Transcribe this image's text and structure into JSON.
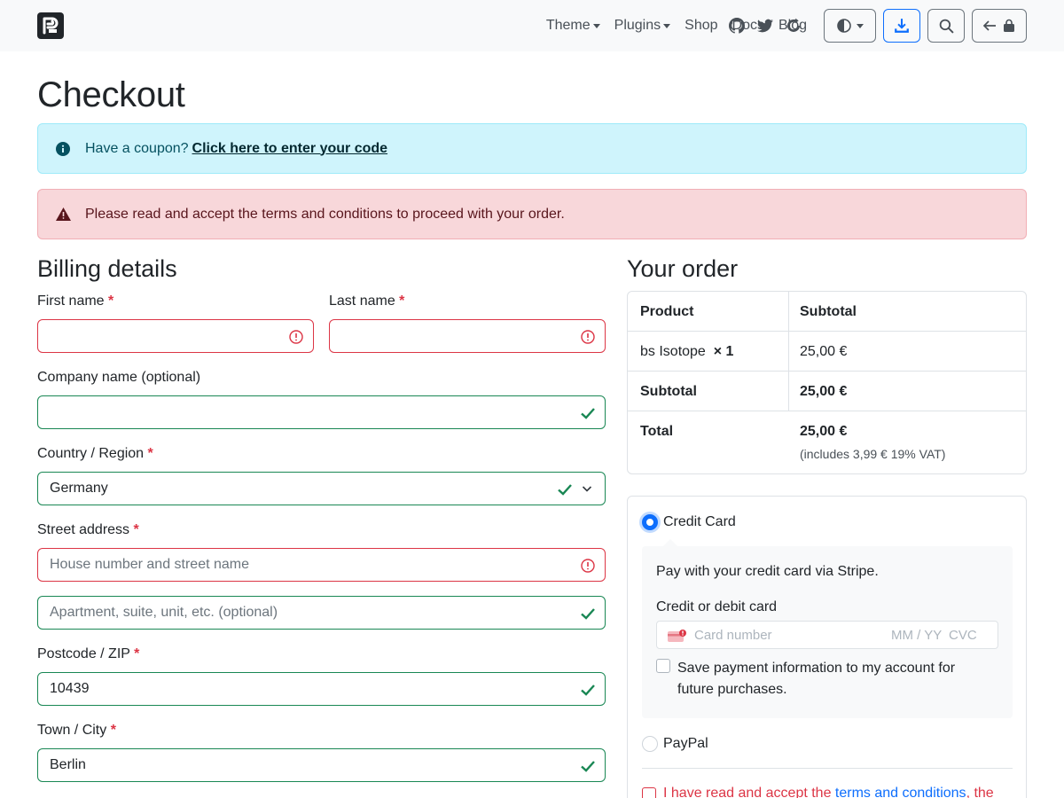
{
  "navbar": {
    "logo": "bs5-logo",
    "links": [
      {
        "label": "Theme",
        "dropdown": true
      },
      {
        "label": "Plugins",
        "dropdown": true
      },
      {
        "label": "Shop",
        "dropdown": false
      },
      {
        "label": "Docs",
        "dropdown": false
      },
      {
        "label": "Blog",
        "dropdown": false
      }
    ],
    "social_icons": [
      "github-icon",
      "twitter-icon",
      "refresh-icon"
    ],
    "buttons": [
      "theme-toggle-icon",
      "download-icon",
      "search-icon",
      "cart-icon"
    ]
  },
  "page": {
    "title": "Checkout"
  },
  "alerts": {
    "coupon_text": "Have a coupon?",
    "coupon_link": "Click here to enter your code",
    "error_text": "Please read and accept the terms and conditions to proceed with your order."
  },
  "billing": {
    "title": "Billing details",
    "required_mark": "*",
    "first_name_label": "First name",
    "last_name_label": "Last name",
    "company_label": "Company name (optional)",
    "country_label": "Country / Region",
    "country_value": "Germany",
    "street_label": "Street address",
    "street_placeholder": "House number and street name",
    "street2_placeholder": "Apartment, suite, unit, etc. (optional)",
    "postcode_label": "Postcode / ZIP",
    "postcode_value": "10439",
    "city_label": "Town / City",
    "city_value": "Berlin"
  },
  "order": {
    "title": "Your order",
    "header_product": "Product",
    "header_subtotal": "Subtotal",
    "item_name": "bs Isotope",
    "item_qty": "× 1",
    "item_price": "25,00 €",
    "subtotal_label": "Subtotal",
    "subtotal_value": "25,00 €",
    "total_label": "Total",
    "total_value": "25,00 €",
    "vat_note": "(includes 3,99 € 19% VAT)"
  },
  "payment": {
    "credit_card_label": "Credit Card",
    "stripe_desc": "Pay with your credit card via Stripe.",
    "card_label": "Credit or debit card",
    "card_placeholder": "Card number",
    "card_expiry_placeholder": "MM / YY",
    "card_cvc_placeholder": "CVC",
    "save_info_line1": "Save payment information to my account for",
    "save_info_line2": "future purchases.",
    "paypal_label": "PayPal",
    "terms_prefix": "I have read and accept the",
    "terms_link": "terms and conditions",
    "terms_suffix": ", the"
  },
  "colors": {
    "primary": "#0d6efd",
    "danger": "#dc3545",
    "success": "#198754",
    "info_bg": "#cff4fc",
    "danger_bg": "#f8d7da"
  }
}
